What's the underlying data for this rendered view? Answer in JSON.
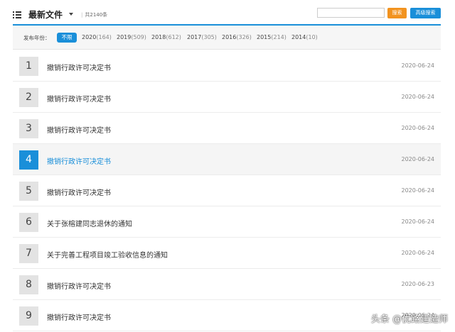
{
  "header": {
    "title": "最新文件",
    "count": "共2140条",
    "search_placeholder": "",
    "search_label": "搜索",
    "advanced_label": "高级搜索"
  },
  "filter": {
    "label": "发布年份：",
    "selected": "不限",
    "years": [
      {
        "year": "2020",
        "count": "(164)"
      },
      {
        "year": "2019",
        "count": "(509)"
      },
      {
        "year": "2018",
        "count": "(612)"
      },
      {
        "year": "2017",
        "count": "(305)"
      },
      {
        "year": "2016",
        "count": "(326)"
      },
      {
        "year": "2015",
        "count": "(214)"
      },
      {
        "year": "2014",
        "count": "(10)"
      }
    ]
  },
  "documents": [
    {
      "num": "1",
      "title": "撤销行政许可决定书",
      "date": "2020-06-24"
    },
    {
      "num": "2",
      "title": "撤销行政许可决定书",
      "date": "2020-06-24"
    },
    {
      "num": "3",
      "title": "撤销行政许可决定书",
      "date": "2020-06-24"
    },
    {
      "num": "4",
      "title": "撤销行政许可决定书",
      "date": "2020-06-24"
    },
    {
      "num": "5",
      "title": "撤销行政许可决定书",
      "date": "2020-06-24"
    },
    {
      "num": "6",
      "title": "关于张榕建同志退休的通知",
      "date": "2020-06-24"
    },
    {
      "num": "7",
      "title": "关于完善工程项目竣工验收信息的通知",
      "date": "2020-06-24"
    },
    {
      "num": "8",
      "title": "撤销行政许可决定书",
      "date": "2020-06-23"
    },
    {
      "num": "9",
      "title": "撤销行政许可决定书",
      "date": "2020-06-24"
    }
  ],
  "watermark": "头条 @优路建造师",
  "colors": {
    "accent": "#1a8fd9",
    "search_button": "#f2931f"
  }
}
